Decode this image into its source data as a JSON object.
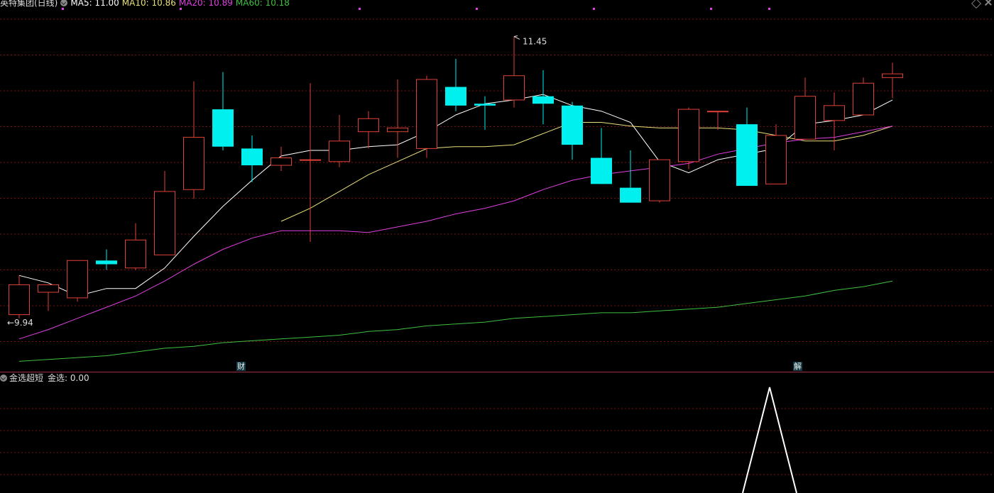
{
  "header": {
    "title": "英特集团(日线)",
    "ma5_label": "MA5: 11.00",
    "ma10_label": "MA10: 10.86",
    "ma20_label": "MA20: 10.89",
    "ma60_label": "MA60: 10.18"
  },
  "indicator": {
    "name": "金选超短",
    "value_label": "金选: 0.00"
  },
  "markers": {
    "cai": "财",
    "jie": "解"
  },
  "colors": {
    "up": "#e0413a",
    "down": "#00f0f0",
    "ma5": "#ffffff",
    "ma10": "#e8e07a",
    "ma20": "#e040e0",
    "ma60": "#40c040",
    "grid": "#7a1010",
    "signal": "#ffffff"
  },
  "chart_data": {
    "type": "candlestick",
    "y_high_label": "11.45",
    "y_low_label": "9.94",
    "ylim": [
      9.7,
      11.6
    ],
    "candles": [
      {
        "o": 9.96,
        "h": 10.17,
        "l": 9.94,
        "c": 10.12
      },
      {
        "o": 10.08,
        "h": 10.12,
        "l": 9.98,
        "c": 10.12
      },
      {
        "o": 10.05,
        "h": 10.25,
        "l": 10.03,
        "c": 10.25
      },
      {
        "o": 10.25,
        "h": 10.31,
        "l": 10.2,
        "c": 10.23
      },
      {
        "o": 10.21,
        "h": 10.45,
        "l": 10.2,
        "c": 10.36
      },
      {
        "o": 10.28,
        "h": 10.73,
        "l": 10.31,
        "c": 10.62
      },
      {
        "o": 10.63,
        "h": 11.21,
        "l": 10.58,
        "c": 10.91
      },
      {
        "o": 11.06,
        "h": 11.26,
        "l": 10.84,
        "c": 10.86
      },
      {
        "o": 10.85,
        "h": 10.92,
        "l": 10.67,
        "c": 10.76
      },
      {
        "o": 10.76,
        "h": 10.86,
        "l": 10.73,
        "c": 10.8
      },
      {
        "o": 10.79,
        "h": 11.2,
        "l": 10.35,
        "c": 10.79
      },
      {
        "o": 10.78,
        "h": 11.03,
        "l": 10.75,
        "c": 10.89
      },
      {
        "o": 10.94,
        "h": 11.05,
        "l": 10.85,
        "c": 11.01
      },
      {
        "o": 10.94,
        "h": 11.22,
        "l": 10.8,
        "c": 10.96
      },
      {
        "o": 10.85,
        "h": 11.24,
        "l": 10.8,
        "c": 11.22
      },
      {
        "o": 11.18,
        "h": 11.33,
        "l": 11.05,
        "c": 11.08
      },
      {
        "o": 11.09,
        "h": 11.13,
        "l": 10.95,
        "c": 11.08
      },
      {
        "o": 11.11,
        "h": 11.45,
        "l": 11.07,
        "c": 11.24
      },
      {
        "o": 11.13,
        "h": 11.27,
        "l": 10.98,
        "c": 11.09
      },
      {
        "o": 11.08,
        "h": 11.1,
        "l": 10.79,
        "c": 10.87
      },
      {
        "o": 10.8,
        "h": 10.96,
        "l": 10.69,
        "c": 10.66
      },
      {
        "o": 10.64,
        "h": 10.84,
        "l": 10.58,
        "c": 10.56
      },
      {
        "o": 10.57,
        "h": 10.75,
        "l": 10.56,
        "c": 10.79
      },
      {
        "o": 10.78,
        "h": 11.07,
        "l": 10.74,
        "c": 11.06
      },
      {
        "o": 11.05,
        "h": 11.05,
        "l": 10.95,
        "c": 11.05
      },
      {
        "o": 10.98,
        "h": 11.07,
        "l": 10.75,
        "c": 10.65
      },
      {
        "o": 10.66,
        "h": 10.98,
        "l": 10.66,
        "c": 10.92
      },
      {
        "o": 10.9,
        "h": 11.23,
        "l": 10.91,
        "c": 11.13
      },
      {
        "o": 11.0,
        "h": 11.15,
        "l": 10.84,
        "c": 11.08
      },
      {
        "o": 11.03,
        "h": 11.23,
        "l": 11.03,
        "c": 11.2
      },
      {
        "o": 11.23,
        "h": 11.31,
        "l": 11.12,
        "c": 11.25
      }
    ],
    "series": [
      {
        "name": "MA5",
        "values": [
          10.17,
          10.13,
          10.06,
          10.1,
          10.1,
          10.21,
          10.38,
          10.54,
          10.68,
          10.81,
          10.84,
          10.84,
          10.86,
          10.87,
          10.94,
          11.03,
          11.09,
          11.11,
          11.14,
          11.08,
          11.05,
          10.99,
          10.78,
          10.72,
          10.79,
          10.82,
          10.85,
          10.98,
          11.0,
          11.03,
          11.11
        ]
      },
      {
        "name": "MA10",
        "values": [
          null,
          null,
          null,
          null,
          null,
          null,
          null,
          null,
          null,
          10.46,
          10.53,
          10.62,
          10.71,
          10.78,
          10.85,
          10.86,
          10.86,
          10.87,
          10.93,
          10.99,
          10.99,
          10.97,
          10.96,
          10.96,
          10.96,
          10.95,
          10.92,
          10.89,
          10.89,
          10.92,
          10.97
        ]
      },
      {
        "name": "MA20",
        "values": [
          9.83,
          9.88,
          9.94,
          10.0,
          10.06,
          10.14,
          10.23,
          10.31,
          10.37,
          10.41,
          10.41,
          10.41,
          10.4,
          10.43,
          10.46,
          10.5,
          10.53,
          10.57,
          10.63,
          10.68,
          10.71,
          10.73,
          10.75,
          10.77,
          10.82,
          10.85,
          10.88,
          10.9,
          10.91,
          10.94,
          10.97
        ]
      },
      {
        "name": "MA60",
        "values": [
          9.71,
          9.72,
          9.73,
          9.74,
          9.76,
          9.78,
          9.79,
          9.81,
          9.82,
          9.83,
          9.84,
          9.85,
          9.87,
          9.88,
          9.9,
          9.91,
          9.92,
          9.94,
          9.95,
          9.96,
          9.97,
          9.97,
          9.98,
          9.99,
          10.0,
          10.02,
          10.04,
          10.06,
          10.09,
          10.11,
          10.14
        ]
      }
    ],
    "indicator_signal": {
      "peak_index": 26,
      "value": 1.0
    }
  }
}
